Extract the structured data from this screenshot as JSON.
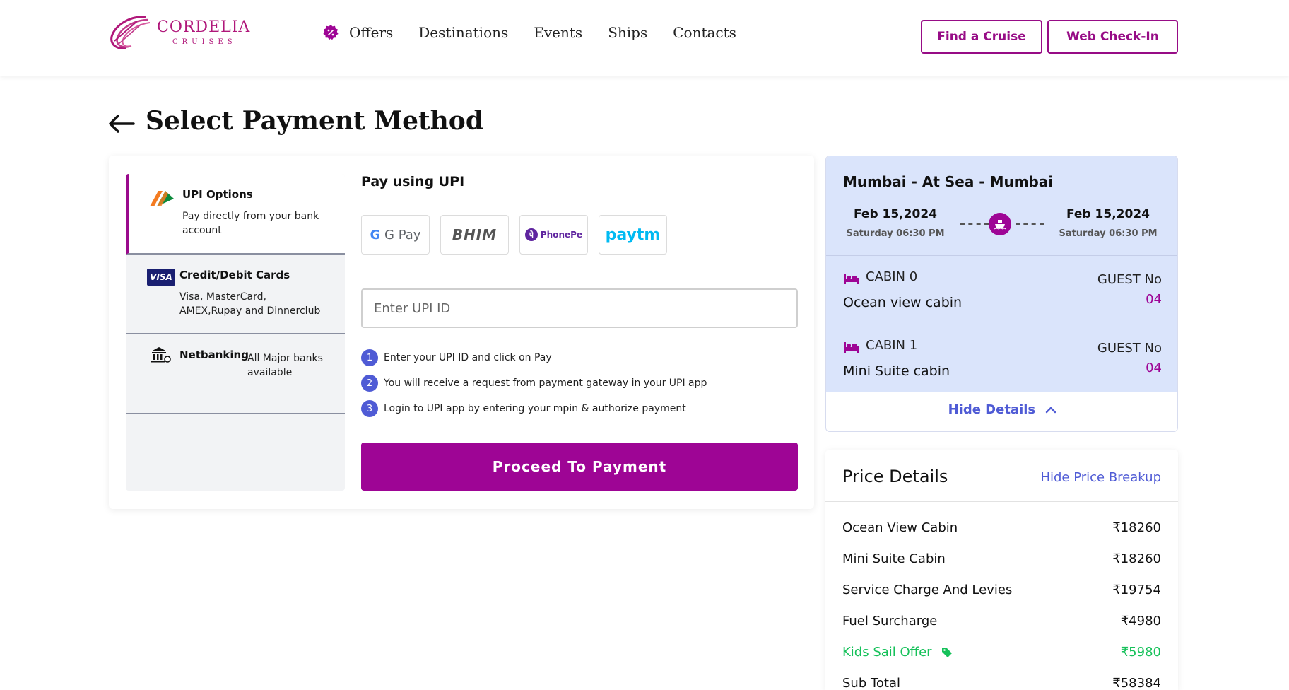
{
  "header": {
    "brand": "CORDELIA",
    "brand_sub": "CRUISES",
    "nav": [
      "Offers",
      "Destinations",
      "Events",
      "Ships",
      "Contacts"
    ],
    "find_cruise": "Find a Cruise",
    "web_checkin": "Web Check-In",
    "accent_color": "#970c86"
  },
  "page": {
    "title": "Select Payment Method"
  },
  "methods": [
    {
      "title": "UPI Options",
      "desc": "Pay directly from your bank account",
      "icon": "upi-icon",
      "active": true
    },
    {
      "title": "Credit/Debit Cards",
      "desc": "Visa, MasterCard, AMEX,Rupay and Dinnerclub",
      "icon": "visa-icon",
      "badge": "VISA"
    },
    {
      "title": "Netbanking",
      "desc": "All Major banks available",
      "icon": "bank-icon"
    }
  ],
  "upi": {
    "title": "Pay using UPI",
    "apps": [
      "G Pay",
      "BHIM",
      "PhonePe",
      "paytm"
    ],
    "input_placeholder": "Enter UPI ID",
    "steps": [
      {
        "num": "1",
        "text": "Enter your UPI ID and click on Pay"
      },
      {
        "num": "2",
        "text": "You will receive a request from payment gateway in your UPI app"
      },
      {
        "num": "3",
        "text": "Login to UPI app by entering your mpin & authorize payment"
      }
    ],
    "proceed": "Proceed To Payment"
  },
  "trip": {
    "route": "Mumbai - At Sea - Mumbai",
    "depart": {
      "date": "Feb 15,2024",
      "time": "Saturday 06:30 PM"
    },
    "arrive": {
      "date": "Feb 15,2024",
      "time": "Saturday 06:30 PM"
    },
    "cabins": [
      {
        "label": "CABIN 0",
        "type": "Ocean view cabin",
        "guest_label": "GUEST No",
        "guests": "04"
      },
      {
        "label": "CABIN 1",
        "type": "Mini Suite cabin",
        "guest_label": "GUEST No",
        "guests": "04"
      }
    ],
    "hide_details": "Hide Details"
  },
  "price": {
    "title": "Price Details",
    "toggle": "Hide Price Breakup",
    "rows": [
      {
        "label": "Ocean View Cabin",
        "value": "₹18260"
      },
      {
        "label": "Mini Suite Cabin",
        "value": "₹18260"
      },
      {
        "label": "Service Charge And Levies",
        "value": "₹19754"
      },
      {
        "label": "Fuel Surcharge",
        "value": "₹4980"
      },
      {
        "label": "Kids Sail Offer",
        "value": "₹5980",
        "discount": true
      },
      {
        "label": "Sub Total",
        "value": "₹58384"
      }
    ],
    "discount_color": "#16c15a"
  }
}
